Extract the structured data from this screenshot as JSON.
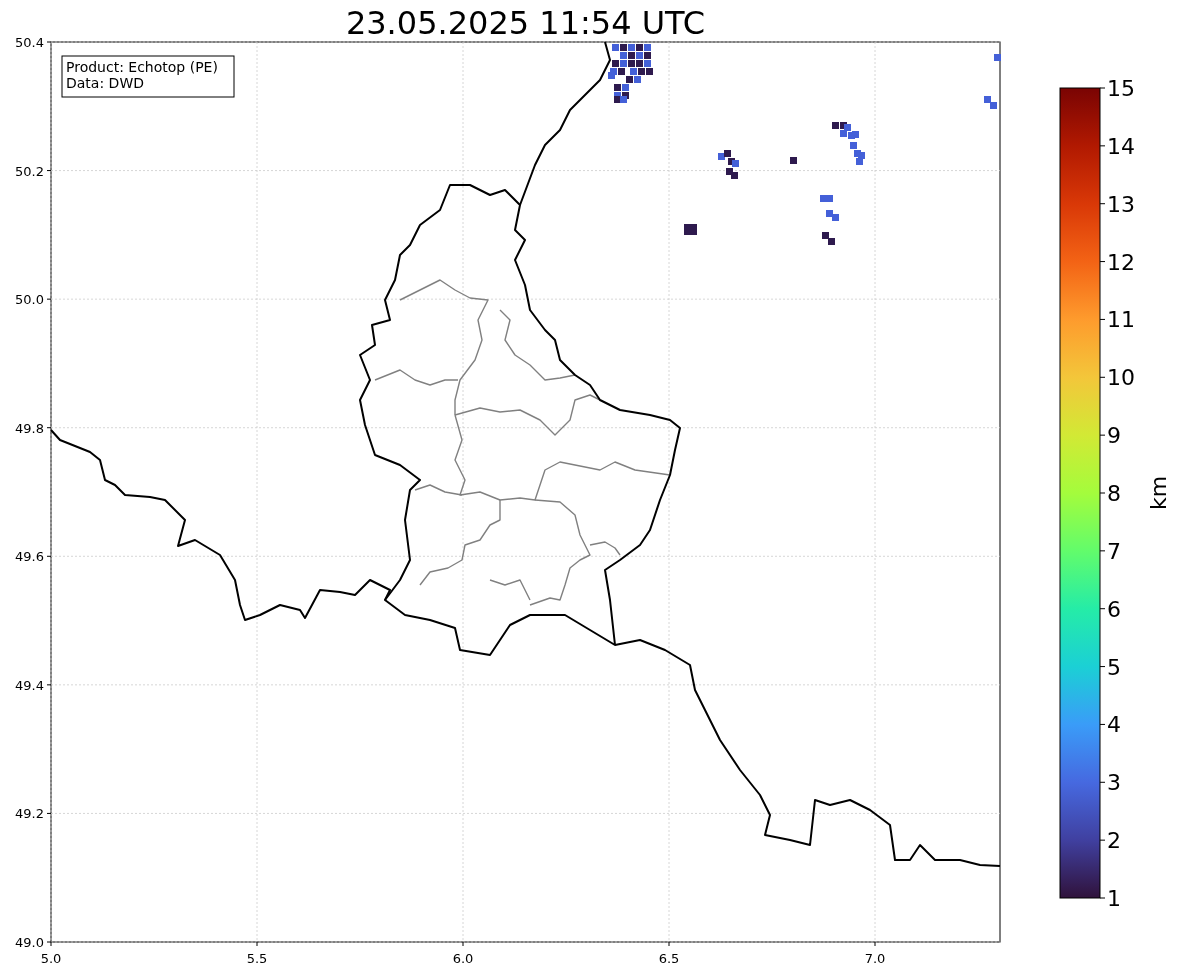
{
  "title": "23.05.2025 11:54 UTC",
  "info_box": {
    "lines": [
      "Product: Echotop (PE)",
      "Data: DWD"
    ]
  },
  "x_ticks": [
    "5.0",
    "5.5",
    "6.0",
    "6.5",
    "7.0"
  ],
  "y_ticks": [
    "50.4",
    "50.2",
    "50.0",
    "49.8",
    "49.6",
    "49.4",
    "49.2",
    "49.0"
  ],
  "colorbar": {
    "label": "km",
    "ticks": [
      "15",
      "14",
      "13",
      "12",
      "11",
      "10",
      "9",
      "8",
      "7",
      "6",
      "5",
      "4",
      "3",
      "2",
      "1"
    ]
  }
}
